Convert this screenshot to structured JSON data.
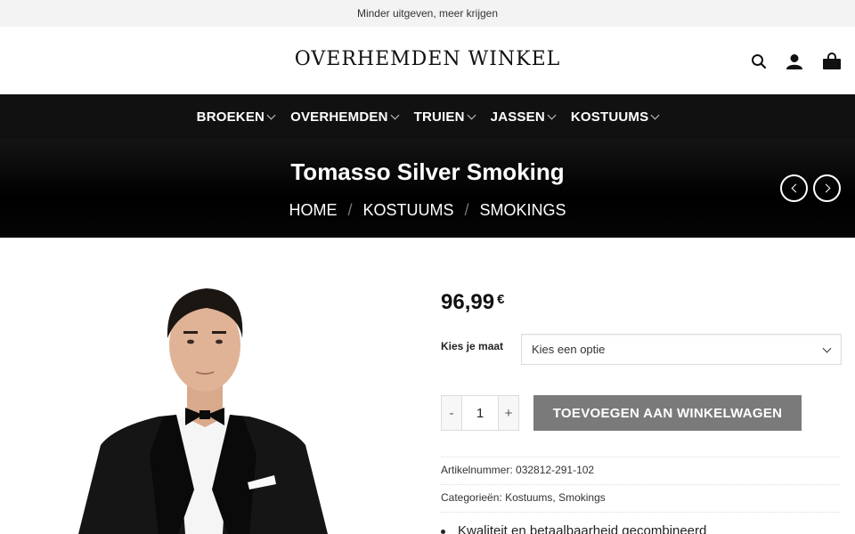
{
  "topbar": {
    "text": "Minder uitgeven, meer krijgen",
    "left_glyph": "",
    "right_glyph": ""
  },
  "header": {
    "logo": "OVERHEMDEN WINKEL",
    "icons": [
      "search-icon",
      "account-icon",
      "cart-icon"
    ]
  },
  "nav": {
    "items": [
      {
        "label": "BROEKEN"
      },
      {
        "label": "OVERHEMDEN"
      },
      {
        "label": "TRUIEN"
      },
      {
        "label": "JASSEN"
      },
      {
        "label": "KOSTUUMS"
      }
    ]
  },
  "hero": {
    "title": "Tomasso Silver Smoking",
    "breadcrumb": [
      "HOME",
      "KOSTUUMS",
      "SMOKINGS"
    ],
    "separator": "/"
  },
  "product": {
    "price_amount": "96,99",
    "price_currency": "€",
    "size_label": "Kies je maat",
    "size_select_value": "Kies een optie",
    "qty_minus": "-",
    "qty_value": "1",
    "qty_plus": "+",
    "add_to_cart": "TOEVOEGEN AAN WINKELWAGEN",
    "sku_label": "Artikelnummer:",
    "sku_value": "032812-291-102",
    "categories_label": "Categorieën:",
    "categories": [
      "Kostuums",
      "Smokings"
    ],
    "usp": "Kwaliteit en betaalbaarheid gecombineerd"
  },
  "colors": {
    "nav_bg": "#111111",
    "add_button": "#7a7a7a",
    "topbar_bg": "#f3f3f3"
  }
}
